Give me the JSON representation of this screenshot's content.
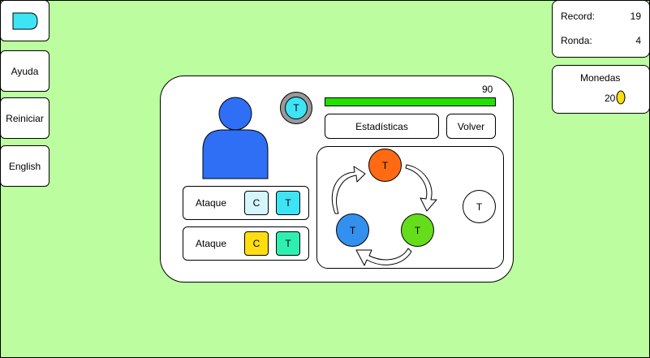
{
  "menu": {
    "logo_icon": "tag-icon",
    "items": [
      {
        "label": "Ayuda"
      },
      {
        "label": "Reiniciar"
      },
      {
        "label": "English"
      }
    ]
  },
  "stats": {
    "record_label": "Record:",
    "record_value": "19",
    "round_label": "Ronda:",
    "round_value": "4"
  },
  "coins": {
    "label": "Monedas",
    "value": "20",
    "icon": "coin-icon"
  },
  "character": {
    "avatar_icon": "person-icon",
    "type_badge": "T",
    "health_value": "90",
    "health_fraction": 1.0,
    "stats_button": "Estadísticas",
    "back_button": "Volver",
    "attacks": [
      {
        "label": "Ataque",
        "chips": [
          "C",
          "T"
        ]
      },
      {
        "label": "Ataque",
        "chips": [
          "C",
          "T"
        ]
      }
    ]
  },
  "cycle": {
    "nodes": [
      "T",
      "T",
      "T"
    ],
    "extra_node": "T"
  },
  "colors": {
    "background": "#bbfd9f",
    "avatar": "#2f6ff5",
    "badge": "#3de4f5",
    "health_bar": "#22e000",
    "node_orange": "#ff6a13",
    "node_green": "#66dd1a",
    "node_blue": "#3390ee",
    "chip_light_cyan": "#d6f6ff",
    "chip_cyan": "#3de4f5",
    "chip_yellow": "#ffdd11",
    "chip_teal": "#2df0b0",
    "coin": "#ffdd11"
  }
}
